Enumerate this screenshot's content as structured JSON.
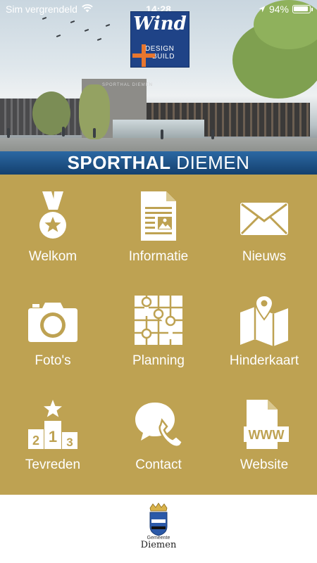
{
  "status_bar": {
    "carrier": "Sim vergrendeld",
    "time": "14:28",
    "battery": "94%"
  },
  "header": {
    "logo_word": "Wind",
    "logo_sub_1": "DESIGN",
    "logo_sub_2": "BUILD",
    "building_sign": "SPORTHAL DIEMEN",
    "title_bold": "SPORTHAL",
    "title_regular": "DIEMEN"
  },
  "menu": {
    "items": [
      {
        "label": "Welkom",
        "icon": "medal-icon"
      },
      {
        "label": "Informatie",
        "icon": "document-icon"
      },
      {
        "label": "Nieuws",
        "icon": "envelope-icon"
      },
      {
        "label": "Foto's",
        "icon": "camera-icon"
      },
      {
        "label": "Planning",
        "icon": "planning-grid-icon"
      },
      {
        "label": "Hinderkaart",
        "icon": "map-pin-icon"
      },
      {
        "label": "Tevreden",
        "icon": "podium-icon"
      },
      {
        "label": "Contact",
        "icon": "phone-bubble-icon"
      },
      {
        "label": "Website",
        "icon": "www-document-icon"
      }
    ],
    "podium_numbers": [
      "2",
      "1",
      "3"
    ],
    "www_text": "WWW"
  },
  "footer": {
    "small_text": "Gemeente",
    "big_text": "Diemen"
  },
  "colors": {
    "menu_background": "#bea252",
    "title_bar": "#1f5a92",
    "logo_blue": "#1f4387",
    "logo_accent": "#e8762e"
  }
}
